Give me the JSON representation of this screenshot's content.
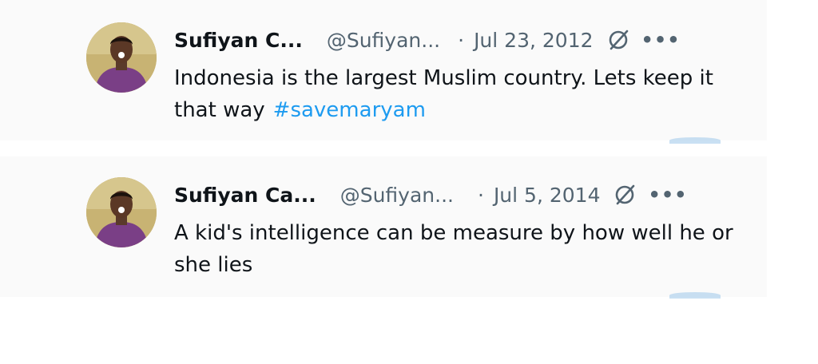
{
  "tweets": [
    {
      "display_name": "Sufiyan C...",
      "handle": "@Sufiyan...",
      "dot": "·",
      "date": "Jul 23, 2012",
      "text": "Indonesia is the largest Muslim country.  Lets keep it that way",
      "hashtag": "#savemaryam",
      "more": "•••"
    },
    {
      "display_name": "Sufiyan Ca...",
      "handle": "@Sufiyan...",
      "dot": "·",
      "date": "Jul 5, 2014",
      "text": "A kid's intelligence can be measure by how well he or she lies",
      "more": "•••"
    }
  ],
  "colors": {
    "text": "#0f1419",
    "secondary": "#536471",
    "hashtag": "#1d9bf0"
  },
  "icons": [
    "grok-icon",
    "more-icon"
  ]
}
